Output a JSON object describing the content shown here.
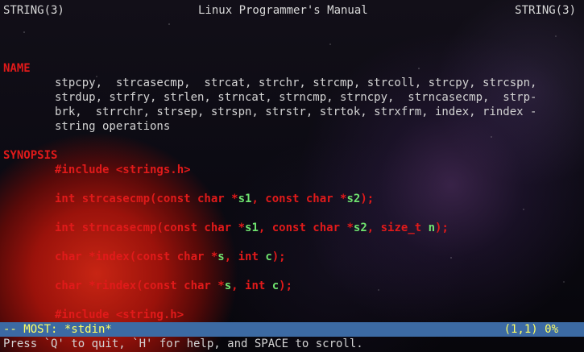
{
  "header": {
    "left": "STRING(3)",
    "center": "Linux Programmer's Manual",
    "right": "STRING(3)"
  },
  "sections": {
    "name_heading": "NAME",
    "name_lines": [
      "stpcpy,  strcasecmp,  strcat, strchr, strcmp, strcoll, strcpy, strcspn,",
      "strdup, strfry, strlen, strncat, strncmp, strncpy,  strncasecmp,  strp-",
      "brk,  strrchr, strsep, strspn, strstr, strtok, strxfrm, index, rindex -",
      "string operations"
    ],
    "synopsis_heading": "SYNOPSIS",
    "synopsis_lines": [
      [
        {
          "t": "#include <strings.h>",
          "c": "code"
        }
      ],
      [
        {
          "t": "int strcasecmp(const char *",
          "c": "code"
        },
        {
          "t": "s1",
          "c": "param"
        },
        {
          "t": ", const char *",
          "c": "code"
        },
        {
          "t": "s2",
          "c": "param"
        },
        {
          "t": ");",
          "c": "code"
        }
      ],
      [
        {
          "t": "int strncasecmp(const char *",
          "c": "code"
        },
        {
          "t": "s1",
          "c": "param"
        },
        {
          "t": ", const char *",
          "c": "code"
        },
        {
          "t": "s2",
          "c": "param"
        },
        {
          "t": ", size_t ",
          "c": "code"
        },
        {
          "t": "n",
          "c": "param"
        },
        {
          "t": ");",
          "c": "code"
        }
      ],
      [
        {
          "t": "char *index(const char *",
          "c": "code"
        },
        {
          "t": "s",
          "c": "param"
        },
        {
          "t": ", int ",
          "c": "code"
        },
        {
          "t": "c",
          "c": "param"
        },
        {
          "t": ");",
          "c": "code"
        }
      ],
      [
        {
          "t": "char *rindex(const char *",
          "c": "code"
        },
        {
          "t": "s",
          "c": "param"
        },
        {
          "t": ", int ",
          "c": "code"
        },
        {
          "t": "c",
          "c": "param"
        },
        {
          "t": ");",
          "c": "code"
        }
      ],
      [
        {
          "t": "#include <string.h>",
          "c": "code"
        }
      ]
    ]
  },
  "statusbar": {
    "left": "-- MOST: *stdin*",
    "right": "(1,1) 0%"
  },
  "message": "Press `Q' to quit, `H' for help, and SPACE to scroll.",
  "colors": {
    "section": "#e01a1a",
    "code": "#e01a1a",
    "param": "#6fe36f",
    "statusbar_bg": "#3c6aa3",
    "statusbar_fg": "#ffff66"
  }
}
